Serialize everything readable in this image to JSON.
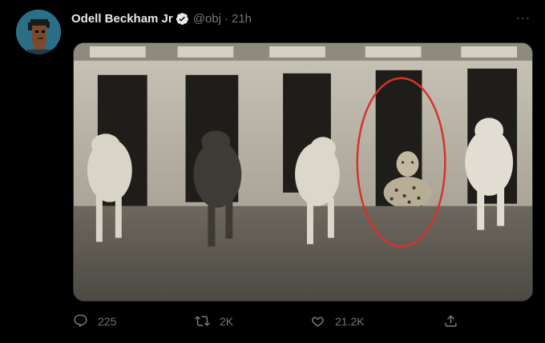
{
  "author": {
    "display_name": "Odell Beckham Jr",
    "handle": "@obj",
    "separator": "·",
    "time_ago": "21h",
    "verified": true,
    "avatar_icon": "pixel-punk-avatar"
  },
  "menu": {
    "more_label": "···"
  },
  "media": {
    "description_icon": "photo",
    "accent_circle_color": "#d6312f"
  },
  "actions": {
    "reply_count": "225",
    "retweet_count": "2K",
    "like_count": "21.2K",
    "share_icon": "share-icon"
  },
  "colors": {
    "background": "#000000",
    "text_primary": "#e7e9ea",
    "text_secondary": "#71767b",
    "verified": "#1d9bf0"
  }
}
